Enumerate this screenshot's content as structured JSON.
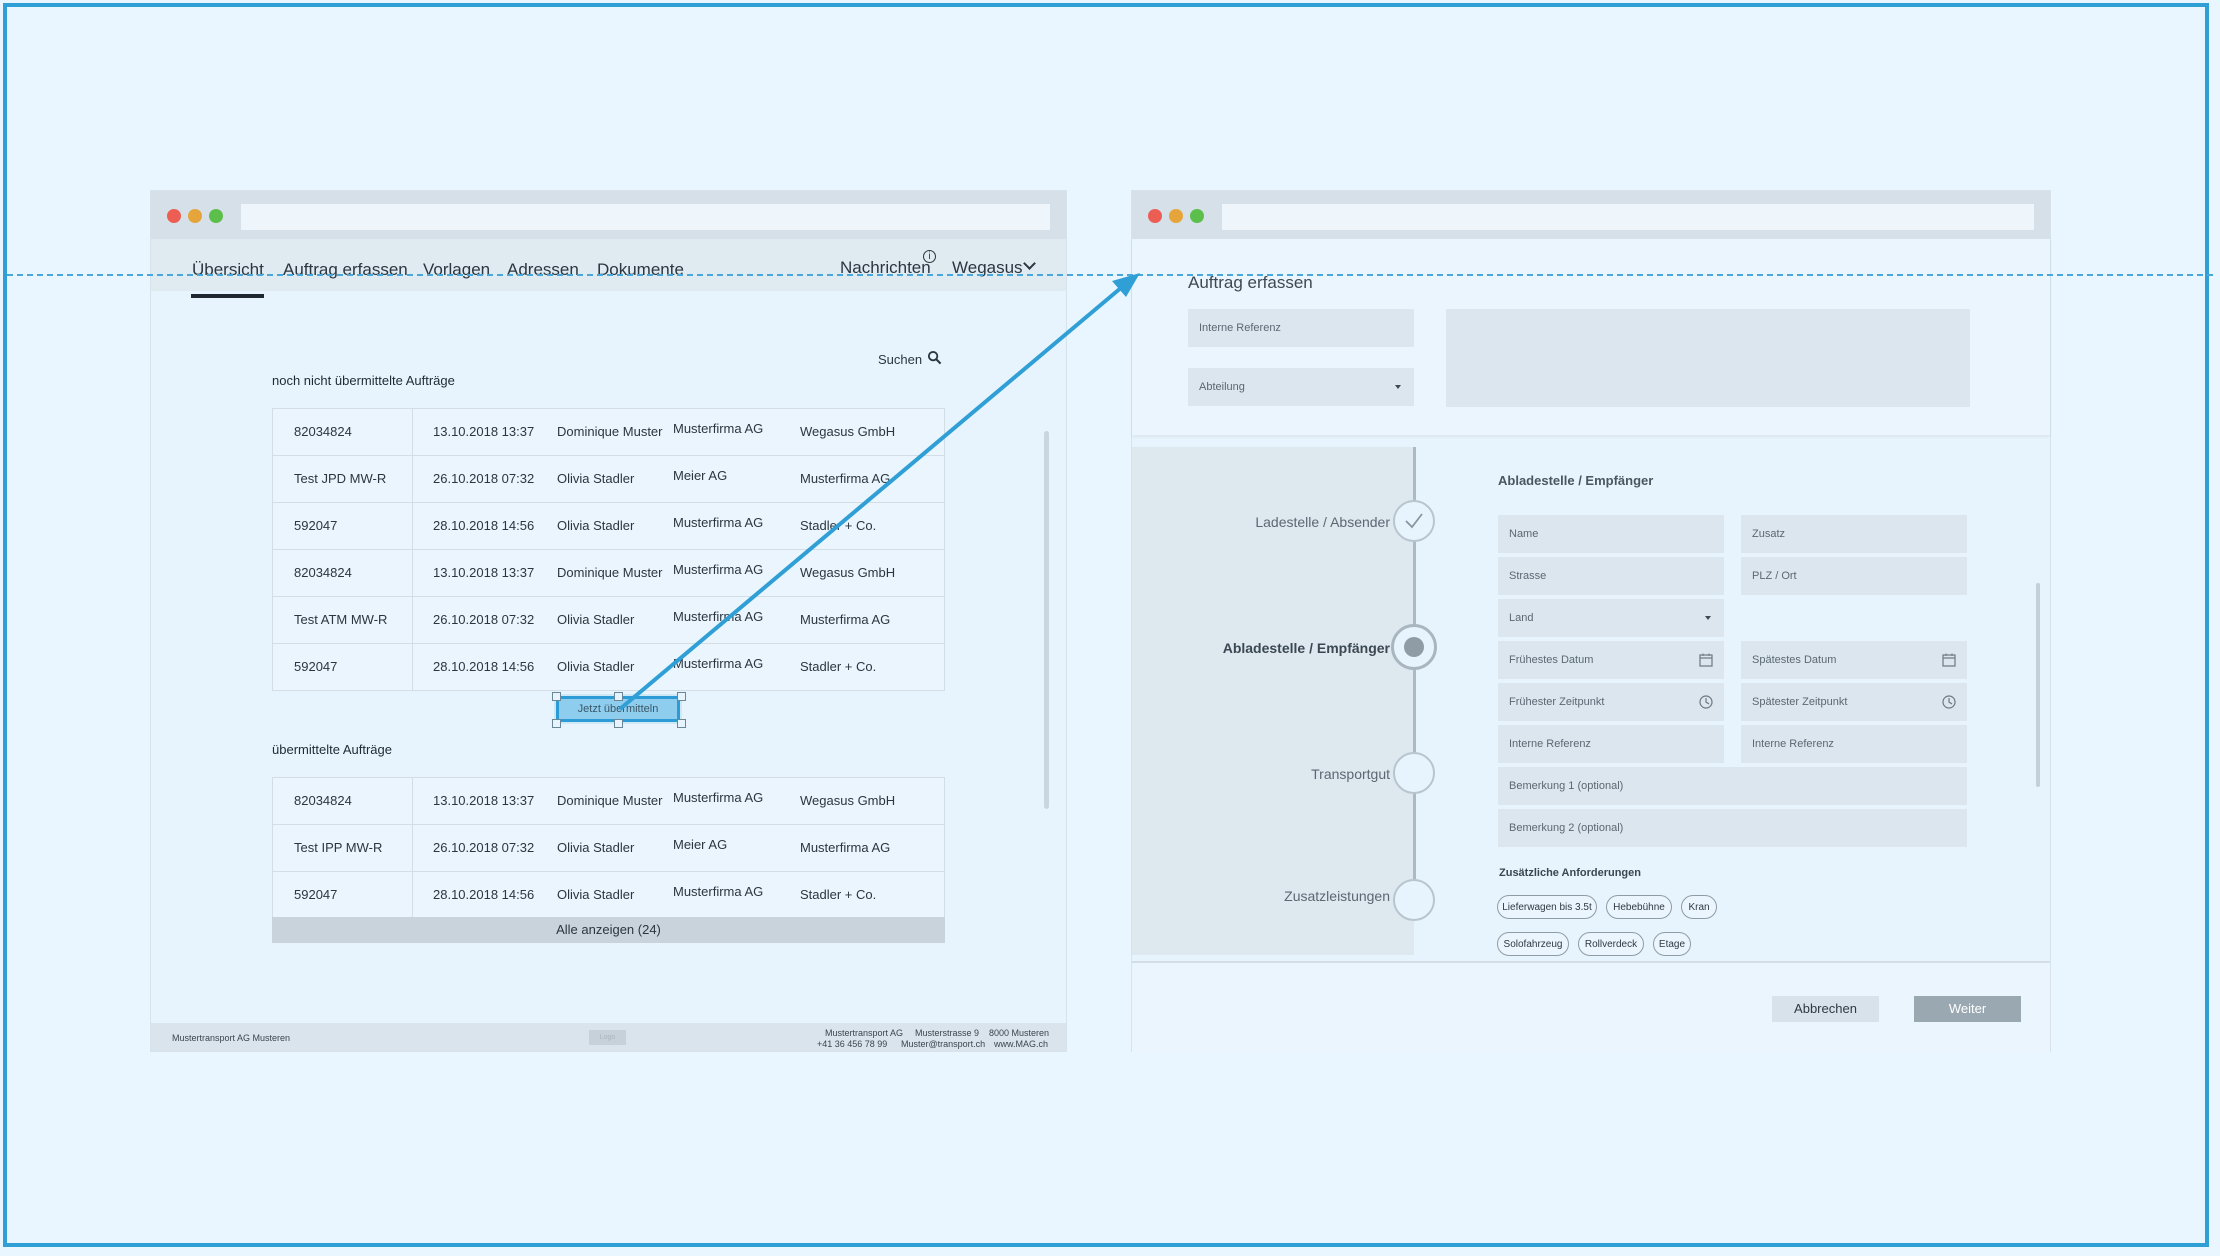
{
  "left_window": {
    "nav": {
      "items": [
        "Übersicht",
        "Auftrag erfassen",
        "Vorlagen",
        "Adressen",
        "Dokumente"
      ],
      "messages_label": "Nachrichten",
      "messages_badge": "i",
      "user_label": "Wegasus"
    },
    "search_label": "Suchen",
    "pending_title": "noch nicht übermittelte Aufträge",
    "pending_orders": [
      [
        "82034824",
        "13.10.2018  13:37",
        "Dominique Muster",
        "Musterfirma AG",
        "Wegasus GmbH"
      ],
      [
        "Test JPD MW-R",
        "26.10.2018 07:32",
        "Olivia Stadler",
        "Meier AG",
        "Musterfirma AG"
      ],
      [
        "592047",
        "28.10.2018 14:56",
        "Olivia Stadler",
        "Musterfirma AG",
        "Stadler + Co."
      ],
      [
        "82034824",
        "13.10.2018  13:37",
        "Dominique Muster",
        "Musterfirma AG",
        "Wegasus GmbH"
      ],
      [
        "Test ATM MW-R",
        "26.10.2018 07:32",
        "Olivia Stadler",
        "Musterfirma AG",
        "Musterfirma AG"
      ],
      [
        "592047",
        "28.10.2018 14:56",
        "Olivia Stadler",
        "Musterfirma AG",
        "Stadler + Co."
      ]
    ],
    "submit_button": "Jetzt übermitteln",
    "sent_title": "übermittelte Aufträge",
    "sent_orders": [
      [
        "82034824",
        "13.10.2018  13:37",
        "Dominique Muster",
        "Musterfirma AG",
        "Wegasus GmbH"
      ],
      [
        "Test IPP MW-R",
        "26.10.2018 07:32",
        "Olivia Stadler",
        "Meier AG",
        "Musterfirma AG"
      ],
      [
        "592047",
        "28.10.2018 14:56",
        "Olivia Stadler",
        "Musterfirma AG",
        "Stadler + Co."
      ]
    ],
    "show_all": "Alle anzeigen (24)",
    "footer": {
      "company": "Mustertransport AG Musteren",
      "tag": "Logo",
      "address_line": [
        "Mustertransport AG",
        "Musterstrasse 9",
        "8000 Musteren"
      ],
      "contact_line": [
        "+41 36 456 78 99",
        "Muster@transport.ch",
        "www.MAG.ch"
      ]
    }
  },
  "right_window": {
    "title": "Auftrag erfassen",
    "internal_ref_placeholder": "Interne Referenz",
    "department_placeholder": "Abteilung",
    "steps": [
      {
        "label": "Ladestelle / Absender",
        "state": "done"
      },
      {
        "label": "Abladestelle / Empfänger",
        "state": "active"
      },
      {
        "label": "Transportgut",
        "state": "todo"
      },
      {
        "label": "Zusatzleistungen",
        "state": "todo"
      }
    ],
    "form_heading": "Abladestelle / Empfänger",
    "fields": {
      "name": "Name",
      "zusatz": "Zusatz",
      "strasse": "Strasse",
      "plz_ort": "PLZ / Ort",
      "land": "Land",
      "earliest_date": "Frühestes Datum",
      "latest_date": "Spätestes Datum",
      "earliest_time": "Frühester Zeitpunkt",
      "latest_time": "Spätester Zeitpunkt",
      "internal_ref_1": "Interne Referenz",
      "internal_ref_2": "Interne Referenz",
      "remark_1": "Bemerkung 1 (optional)",
      "remark_2": "Bemerkung 2 (optional)"
    },
    "requirements_heading": "Zusätzliche Anforderungen",
    "requirements": [
      "Lieferwagen bis 3.5t",
      "Hebebühne",
      "Kran",
      "Solofahrzeug",
      "Rollverdeck",
      "Etage"
    ],
    "cancel_button": "Abbrechen",
    "next_button": "Weiter"
  },
  "colors": {
    "background": "#e9f6ff",
    "accent": "#2f9fd6",
    "primary_button": "#9aa8b2"
  }
}
